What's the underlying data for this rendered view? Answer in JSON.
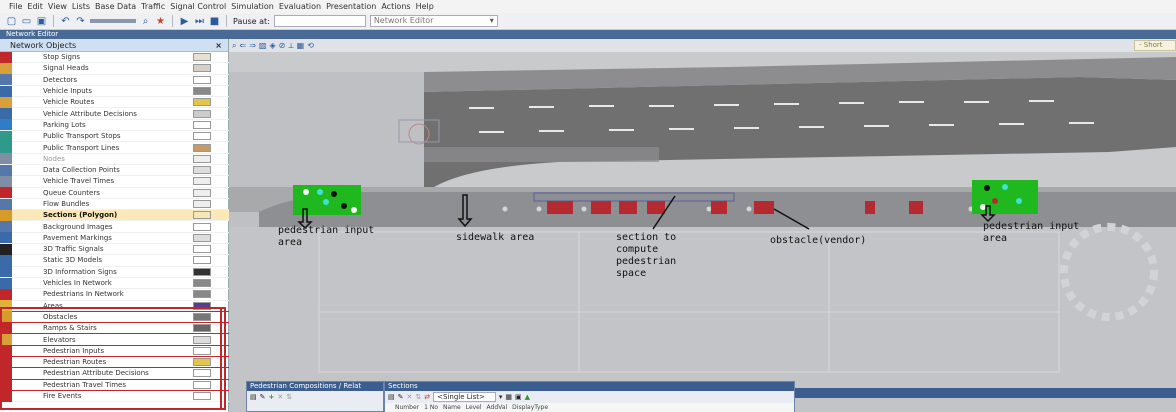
{
  "menu": [
    "File",
    "Edit",
    "View",
    "Lists",
    "Base Data",
    "Traffic",
    "Signal Control",
    "Simulation",
    "Evaluation",
    "Presentation",
    "Actions",
    "Help"
  ],
  "toolbar": {
    "pause_label": "Pause at:",
    "network_select": "Network Editor"
  },
  "window_title": "Network Editor",
  "panel": {
    "title": "Network Objects",
    "close": "×",
    "items": [
      {
        "label": "Stop Signs",
        "color": "#e8e0d0"
      },
      {
        "label": "Signal Heads",
        "color": "#d8d0c8"
      },
      {
        "label": "Detectors",
        "color": "#ffffff"
      },
      {
        "label": "Vehicle Inputs",
        "color": "#888888"
      },
      {
        "label": "Vehicle Routes",
        "color": "#e5c44a"
      },
      {
        "label": "Vehicle Attribute Decisions",
        "color": "#cccccc"
      },
      {
        "label": "Parking Lots",
        "color": "#ffffff"
      },
      {
        "label": "Public Transport Stops",
        "color": "#ffffff"
      },
      {
        "label": "Public Transport Lines",
        "color": "#c99a66"
      },
      {
        "label": "Nodes",
        "color": "#eeeeee"
      },
      {
        "label": "Data Collection Points",
        "color": "#dddddd"
      },
      {
        "label": "Vehicle Travel Times",
        "color": "#eeeeee"
      },
      {
        "label": "Queue Counters",
        "color": "#eeeeee"
      },
      {
        "label": "Flow Bundles",
        "color": "#eeeeee"
      },
      {
        "label": "Sections (Polygon)",
        "color": "#f6e7b8"
      },
      {
        "label": "Background Images",
        "color": "#ffffff"
      },
      {
        "label": "Pavement Markings",
        "color": "#dddddd"
      },
      {
        "label": "3D Traffic Signals",
        "color": "#ffffff"
      },
      {
        "label": "Static 3D Models",
        "color": "#ffffff"
      },
      {
        "label": "3D Information Signs",
        "color": "#333333"
      },
      {
        "label": "Vehicles In Network",
        "color": "#888888"
      },
      {
        "label": "Pedestrians In Network",
        "color": "#888888"
      },
      {
        "label": "Areas",
        "color": "#5a3c8c"
      },
      {
        "label": "Obstacles",
        "color": "#777777"
      },
      {
        "label": "Ramps & Stairs",
        "color": "#666666"
      },
      {
        "label": "Elevators",
        "color": "#dddddd"
      },
      {
        "label": "Pedestrian Inputs",
        "color": "#ffffff"
      },
      {
        "label": "Pedestrian Routes",
        "color": "#e5c44a"
      },
      {
        "label": "Pedestrian Attribute Decisions",
        "color": "#ffffff"
      },
      {
        "label": "Pedestrian Travel Times",
        "color": "#ffffff"
      },
      {
        "label": "Fire Events",
        "color": "#ffffff"
      }
    ]
  },
  "canvas": {
    "short_tab": "- Short",
    "annotations": {
      "ped_input_left": "pedestrian input\narea",
      "sidewalk": "sidewalk area",
      "section": "section to\ncompute\npedestrian\nspace",
      "obstacle": "obstacle(vendor)",
      "ped_input_right": "pedestrian input\narea"
    }
  },
  "subwindows": {
    "compositions_title": "Pedestrian Compositions / Relat",
    "sections_title": "Sections",
    "sections_list": "<Single List>",
    "sections_columns": [
      "Number",
      "1 No",
      "Name",
      "Level",
      "AddVal",
      "DisplayType"
    ]
  },
  "colors": {
    "accent": "#4a6a96",
    "annotation_red": "#c0262a",
    "pedestrian_area": "#1fb81f",
    "obstacle": "#b52a30"
  }
}
